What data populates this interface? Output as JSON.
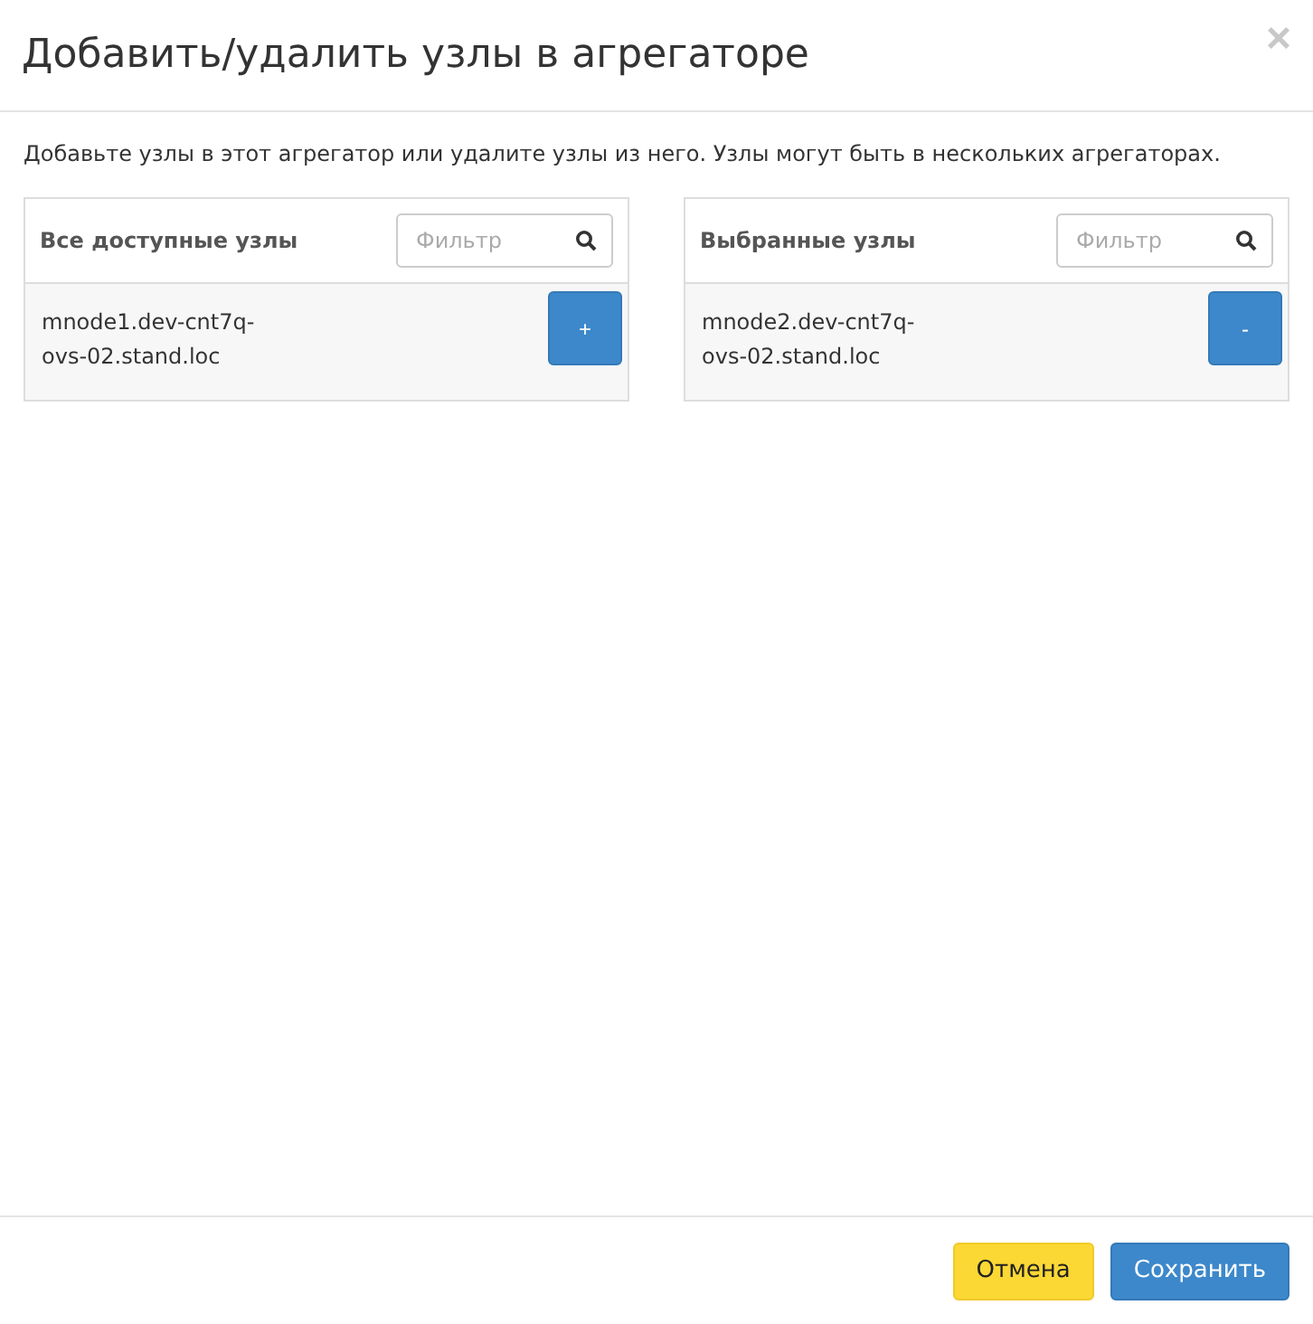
{
  "dialog": {
    "title": "Добавить/удалить узлы в агрегаторе",
    "close": "×"
  },
  "description": "Добавьте узлы в этот агрегатор или удалите узлы из него. Узлы могут быть в нескольких агрегаторах.",
  "panels": [
    {
      "title": "Все доступные узлы",
      "filter": {
        "placeholder": "Фильтр"
      },
      "items": [
        {
          "name": "mnode1.dev-cnt7q-ovs-02.stand.loc",
          "action": "+"
        }
      ]
    },
    {
      "title": "Выбранные узлы",
      "filter": {
        "placeholder": "Фильтр"
      },
      "items": [
        {
          "name": "mnode2.dev-cnt7q-ovs-02.stand.loc",
          "action": "-"
        }
      ]
    }
  ],
  "buttons": [
    {
      "label": "Отмена",
      "kind": "cancel"
    },
    {
      "label": "Сохранить",
      "kind": "primary"
    }
  ]
}
